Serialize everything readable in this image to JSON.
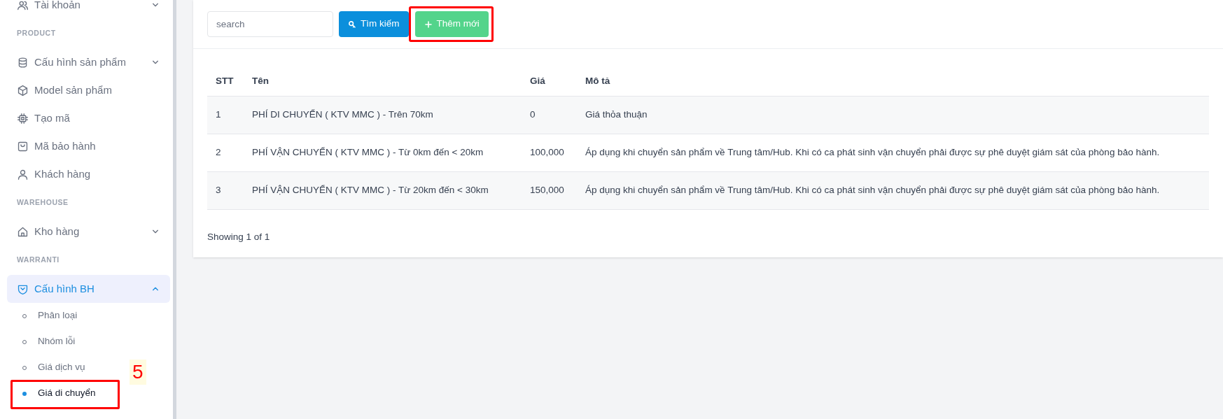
{
  "sidebar": {
    "sections": [
      {
        "items": [
          {
            "kind": "group",
            "label": "Tài khoản",
            "expanded": false
          }
        ]
      },
      {
        "heading": "PRODUCT",
        "items": [
          {
            "kind": "group",
            "label": "Cấu hình sản phẩm",
            "expanded": false
          },
          {
            "kind": "link",
            "label": "Model sản phẩm"
          },
          {
            "kind": "link",
            "label": "Tạo mã"
          },
          {
            "kind": "link",
            "label": "Mã bảo hành"
          },
          {
            "kind": "link",
            "label": "Khách hàng"
          }
        ]
      },
      {
        "heading": "WAREHOUSE",
        "items": [
          {
            "kind": "group",
            "label": "Kho hàng",
            "expanded": false
          }
        ]
      },
      {
        "heading": "WARRANTI",
        "items": [
          {
            "kind": "group",
            "label": "Cấu hình BH",
            "expanded": true,
            "children": [
              {
                "label": "Phân loại",
                "selected": false
              },
              {
                "label": "Nhóm lỗi",
                "selected": false
              },
              {
                "label": "Giá dịch vụ",
                "selected": false
              },
              {
                "label": "Giá di chuyển",
                "selected": true,
                "annotated": true,
                "annotation_label": "5"
              }
            ]
          }
        ]
      }
    ]
  },
  "toolbar": {
    "search": {
      "placeholder": "search"
    },
    "buttons": [
      {
        "kind": "search",
        "label": "Tìm kiếm",
        "annotated": false
      },
      {
        "kind": "add",
        "label": "Thêm mới",
        "annotated": true
      }
    ]
  },
  "table": {
    "columns": [
      "STT",
      "Tên",
      "Giá",
      "Mô tả"
    ],
    "rows": [
      [
        "1",
        "PHÍ DI CHUYỂN ( KTV MMC ) - Trên 70km",
        "0",
        "Giá thỏa thuận"
      ],
      [
        "2",
        "PHÍ VẬN CHUYỂN ( KTV MMC ) - Từ 0km đến < 20km",
        "100,000",
        "Áp dụng khi chuyển sản phẩm về Trung tâm/Hub. Khi có ca phát sinh vận chuyển phải được sự phê duyệt giám sát của phòng bảo hành."
      ],
      [
        "3",
        "PHÍ VẬN CHUYỂN ( KTV MMC ) - Từ 20km đến < 30km",
        "150,000",
        "Áp dụng khi chuyển sản phẩm về Trung tâm/Hub. Khi có ca phát sinh vận chuyển phải được sự phê duyệt giám sát của phòng bảo hành."
      ]
    ]
  },
  "footer": "Showing 1 of 1"
}
